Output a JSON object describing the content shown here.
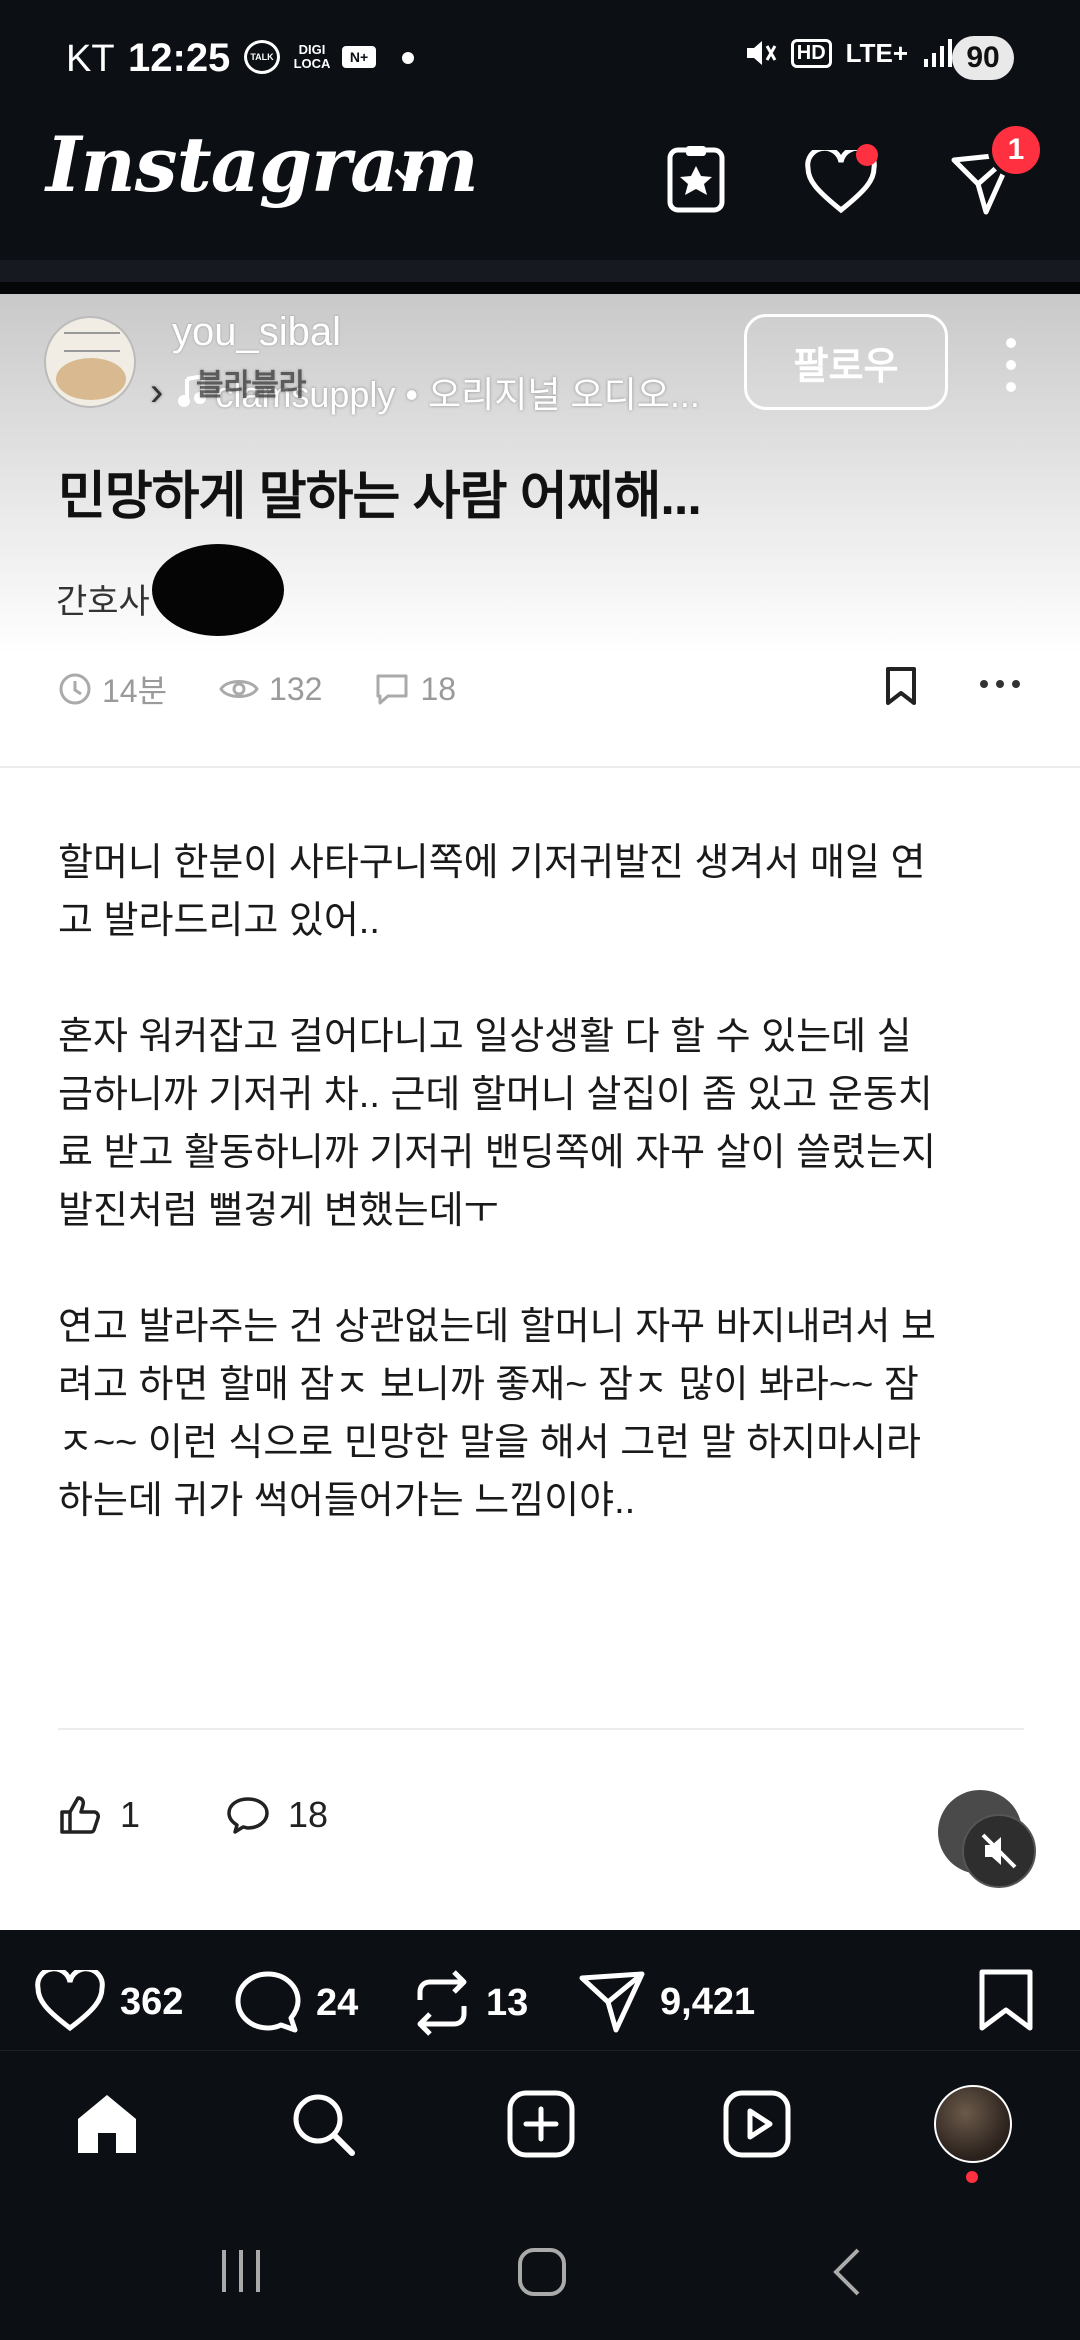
{
  "status_bar": {
    "carrier": "KT",
    "time": "12:25",
    "icon_talk": "TALK",
    "icon_digi": "DIGI LOCA",
    "icon_nplus": "N+",
    "network": "LTE+",
    "hd": "HD",
    "battery": "90"
  },
  "header": {
    "logo": "Instagram",
    "notification_count": "1"
  },
  "post": {
    "username": "you_sibal",
    "audio_prefix": "블라블라",
    "audio": "clamsupply • 오리지널 오디오...",
    "follow_label": "팔로우",
    "title": "민망하게 말하는 사람 어찌해...",
    "author": "간호사",
    "meta": {
      "time": "14분",
      "views": "132",
      "comments": "18"
    },
    "paragraphs": [
      "할머니 한분이 사타구니쪽에 기저귀발진 생겨서 매일 연\n고 발라드리고 있어..",
      "혼자 워커잡고 걸어다니고 일상생활 다 할 수 있는데 실\n금하니까 기저귀 차.. 근데 할머니 살집이 좀 있고 운동치\n료 받고 활동하니까 기저귀 밴딩쪽에 자꾸 살이 쓸렸는지\n발진처럼 뻘겋게 변했는데ㅜ",
      "연고 발라주는 건 상관없는데 할머니 자꾸 바지내려서 보\n려고 하면 할매 잠ㅈ 보니까 좋재~ 잠ㅈ 많이 봐라~~ 잠\nㅈ~~ 이런 식으로 민망한 말을 해서 그런 말 하지마시라\n하는데 귀가 썩어들어가는 느낌이야.."
    ],
    "likes": "1",
    "reply_count": "18"
  },
  "actions": {
    "likes": "362",
    "comments": "24",
    "reposts": "13",
    "shares": "9,421"
  },
  "colors": {
    "badge_red": "#ff3040",
    "app_bg": "#0c0f14"
  }
}
